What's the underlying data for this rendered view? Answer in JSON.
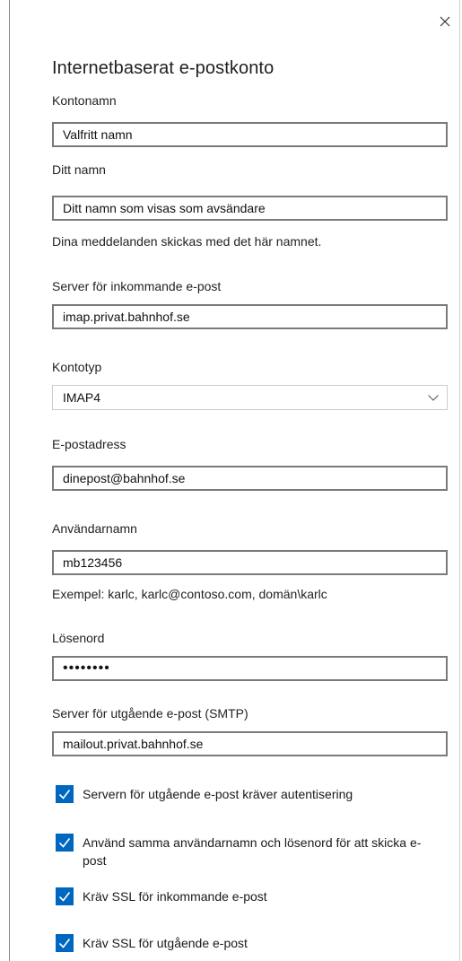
{
  "dialog": {
    "title": "Internetbaserat e-postkonto",
    "close_icon": "close-icon"
  },
  "form": {
    "account_name": {
      "label": "Kontonamn",
      "value": "Valfritt namn"
    },
    "your_name": {
      "label": "Ditt namn",
      "value": "Ditt namn som visas som avsändare",
      "hint": "Dina meddelanden skickas med det här namnet."
    },
    "incoming_server": {
      "label": "Server för inkommande e-post",
      "value": "imap.privat.bahnhof.se"
    },
    "account_type": {
      "label": "Kontotyp",
      "value": "IMAP4"
    },
    "email": {
      "label": "E-postadress",
      "value": "dinepost@bahnhof.se"
    },
    "username": {
      "label": "Användarnamn",
      "value": "mb123456",
      "hint": "Exempel: karlc, karlc@contoso.com, domän\\karlc"
    },
    "password": {
      "label": "Lösenord",
      "value": "••••••••"
    },
    "outgoing_server": {
      "label": "Server för utgående e-post (SMTP)",
      "value": "mailout.privat.bahnhof.se"
    }
  },
  "options": [
    {
      "label": "Servern för utgående e-post kräver autentisering",
      "checked": true
    },
    {
      "label": "Använd samma användarnamn och lösenord för att skicka e-post",
      "checked": true
    },
    {
      "label": "Kräv SSL för inkommande e-post",
      "checked": true
    },
    {
      "label": "Kräv SSL för utgående e-post",
      "checked": true
    }
  ],
  "colors": {
    "accent": "#0067c0",
    "field_border": "#7a7a7a"
  }
}
